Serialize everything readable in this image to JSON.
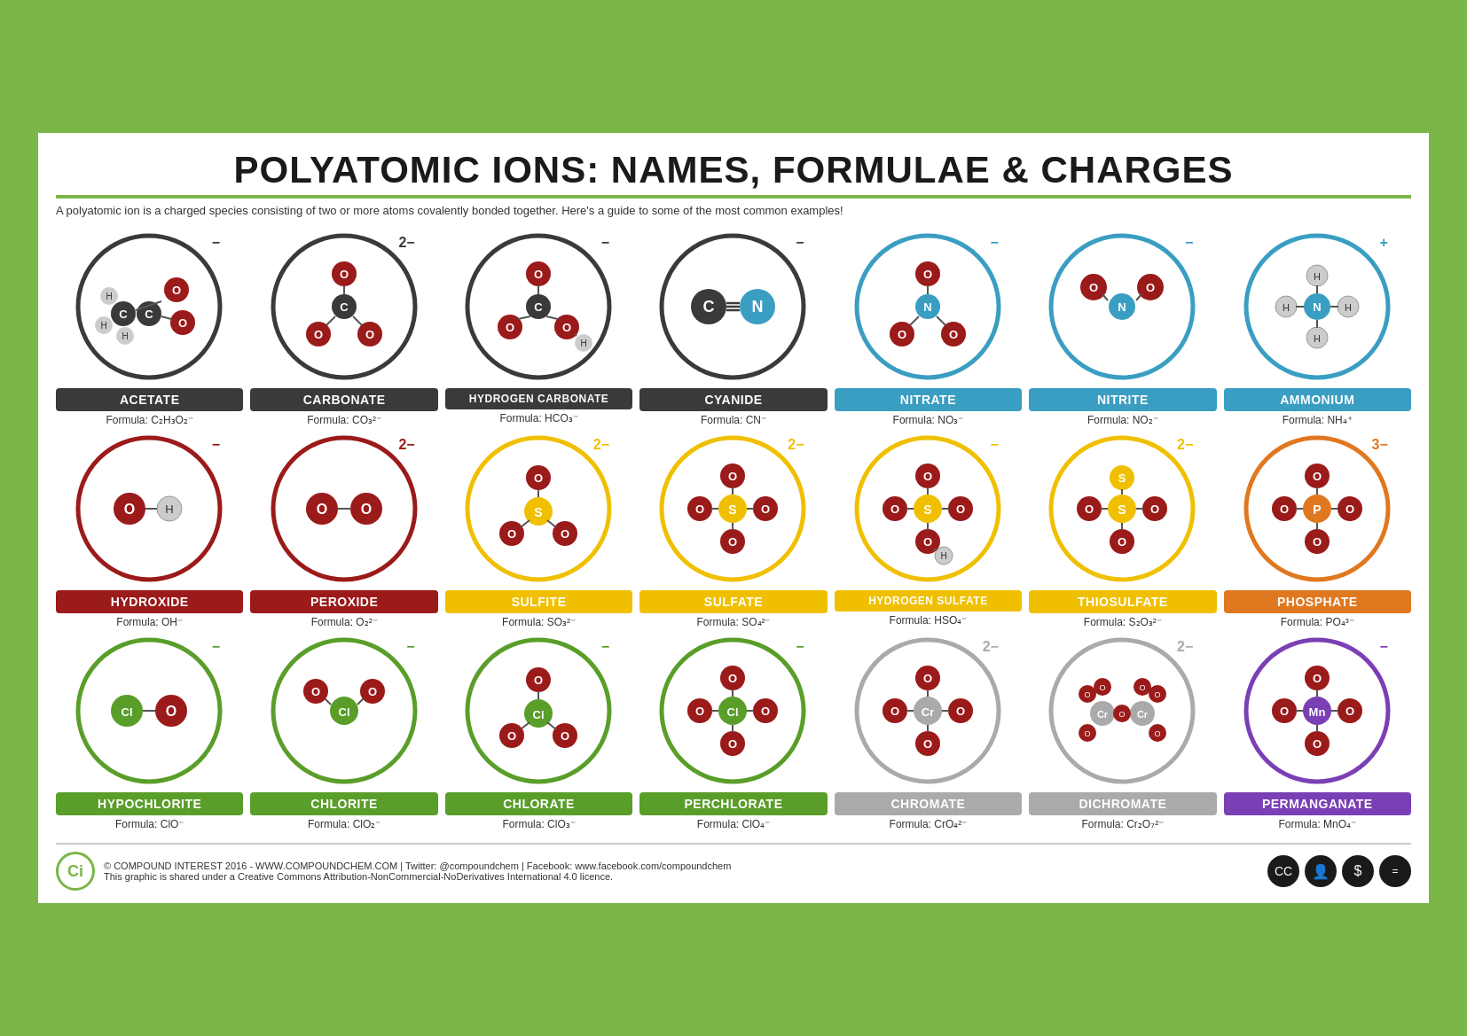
{
  "page": {
    "title": "POLYATOMIC IONS: NAMES, FORMULAE & CHARGES",
    "subtitle": "A polyatomic ion is a charged species consisting of two or more atoms covalently bonded together. Here's a guide to some of the most common examples!",
    "footer": {
      "copyright": "© COMPOUND INTEREST 2016 - WWW.COMPOUNDCHEM.COM | Twitter: @compoundchem | Facebook: www.facebook.com/compoundchem",
      "license": "This graphic is shared under a Creative Commons Attribution-NonCommercial-NoDerivatives International 4.0 licence.",
      "logo": "Ci"
    }
  },
  "ions": [
    {
      "name": "ACETATE",
      "formula": "Formula: C₂H₃O₂⁻",
      "charge": "−",
      "color": "#3a3a3a",
      "circleColor": "dark"
    },
    {
      "name": "CARBONATE",
      "formula": "Formula: CO₃²⁻",
      "charge": "2−",
      "color": "#3a3a3a",
      "circleColor": "dark"
    },
    {
      "name": "HYDROGEN CARBONATE",
      "formula": "Formula: HCO₃⁻",
      "charge": "−",
      "color": "#3a3a3a",
      "circleColor": "dark"
    },
    {
      "name": "CYANIDE",
      "formula": "Formula: CN⁻",
      "charge": "−",
      "color": "#3a3a3a",
      "circleColor": "dark"
    },
    {
      "name": "NITRATE",
      "formula": "Formula: NO₃⁻",
      "charge": "−",
      "color": "#3a9ec2",
      "circleColor": "blue"
    },
    {
      "name": "NITRITE",
      "formula": "Formula: NO₂⁻",
      "charge": "−",
      "color": "#3a9ec2",
      "circleColor": "blue"
    },
    {
      "name": "AMMONIUM",
      "formula": "Formula: NH₄⁺",
      "charge": "+",
      "color": "#3a9ec2",
      "circleColor": "blue"
    },
    {
      "name": "HYDROXIDE",
      "formula": "Formula: OH⁻",
      "charge": "−",
      "color": "#9b1a1a",
      "circleColor": "red"
    },
    {
      "name": "PEROXIDE",
      "formula": "Formula: O₂²⁻",
      "charge": "2−",
      "color": "#9b1a1a",
      "circleColor": "red"
    },
    {
      "name": "SULFITE",
      "formula": "Formula: SO₃²⁻",
      "charge": "2−",
      "color": "#f0c000",
      "circleColor": "yellow"
    },
    {
      "name": "SULFATE",
      "formula": "Formula: SO₄²⁻",
      "charge": "2−",
      "color": "#f0c000",
      "circleColor": "yellow"
    },
    {
      "name": "HYDROGEN SULFATE",
      "formula": "Formula: HSO₄⁻",
      "charge": "−",
      "color": "#f0c000",
      "circleColor": "yellow"
    },
    {
      "name": "THIOSULFATE",
      "formula": "Formula: S₂O₃²⁻",
      "charge": "2−",
      "color": "#f0c000",
      "circleColor": "yellow"
    },
    {
      "name": "PHOSPHATE",
      "formula": "Formula: PO₄³⁻",
      "charge": "3−",
      "color": "#e07820",
      "circleColor": "orange"
    },
    {
      "name": "HYPOCHLORITE",
      "formula": "Formula: ClO⁻",
      "charge": "−",
      "color": "#5a9e2a",
      "circleColor": "green"
    },
    {
      "name": "CHLORITE",
      "formula": "Formula: ClO₂⁻",
      "charge": "−",
      "color": "#5a9e2a",
      "circleColor": "green"
    },
    {
      "name": "CHLORATE",
      "formula": "Formula: ClO₃⁻",
      "charge": "−",
      "color": "#5a9e2a",
      "circleColor": "green"
    },
    {
      "name": "PERCHLORATE",
      "formula": "Formula: ClO₄⁻",
      "charge": "−",
      "color": "#5a9e2a",
      "circleColor": "green"
    },
    {
      "name": "CHROMATE",
      "formula": "Formula: CrO₄²⁻",
      "charge": "2−",
      "color": "#aaaaaa",
      "circleColor": "gray"
    },
    {
      "name": "DICHROMATE",
      "formula": "Formula: Cr₂O₇²⁻",
      "charge": "2−",
      "color": "#aaaaaa",
      "circleColor": "gray"
    },
    {
      "name": "PERMANGANATE",
      "formula": "Formula: MnO₄⁻",
      "charge": "−",
      "color": "#7b3fb5",
      "circleColor": "purple"
    }
  ]
}
